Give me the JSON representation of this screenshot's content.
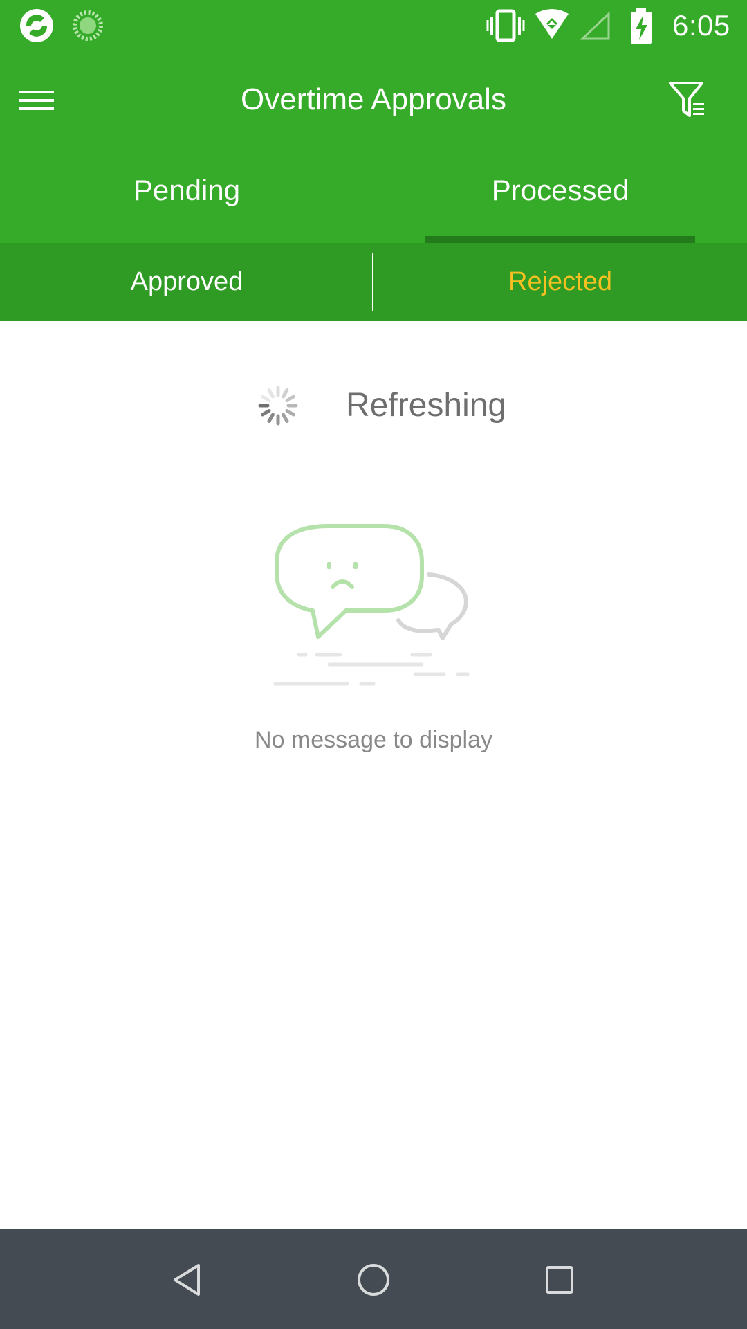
{
  "status_bar": {
    "time": "6:05",
    "icons": [
      "app-logo-icon",
      "loading-circle-icon",
      "vibrate-icon",
      "wifi-icon",
      "signal-icon",
      "battery-charging-icon"
    ]
  },
  "app_bar": {
    "title": "Overtime Approvals",
    "menu_icon": "hamburger-menu-icon",
    "filter_icon": "filter-icon"
  },
  "tabs": {
    "items": [
      {
        "label": "Pending",
        "selected": false
      },
      {
        "label": "Processed",
        "selected": true
      }
    ]
  },
  "sub_tabs": {
    "items": [
      {
        "label": "Approved",
        "selected": false
      },
      {
        "label": "Rejected",
        "selected": true
      }
    ],
    "selected_color": "#f6c022"
  },
  "content": {
    "refresh_label": "Refreshing",
    "empty_message": "No message to display",
    "empty_icon": "sad-chat-bubble-icon"
  },
  "nav_bar": {
    "icons": [
      "back-icon",
      "home-icon",
      "recent-apps-icon"
    ]
  },
  "colors": {
    "primary_green": "#36ab2a",
    "sub_tab_green": "#2f9b24",
    "indicator_green": "#237b1b",
    "nav_bar": "#444b52"
  }
}
